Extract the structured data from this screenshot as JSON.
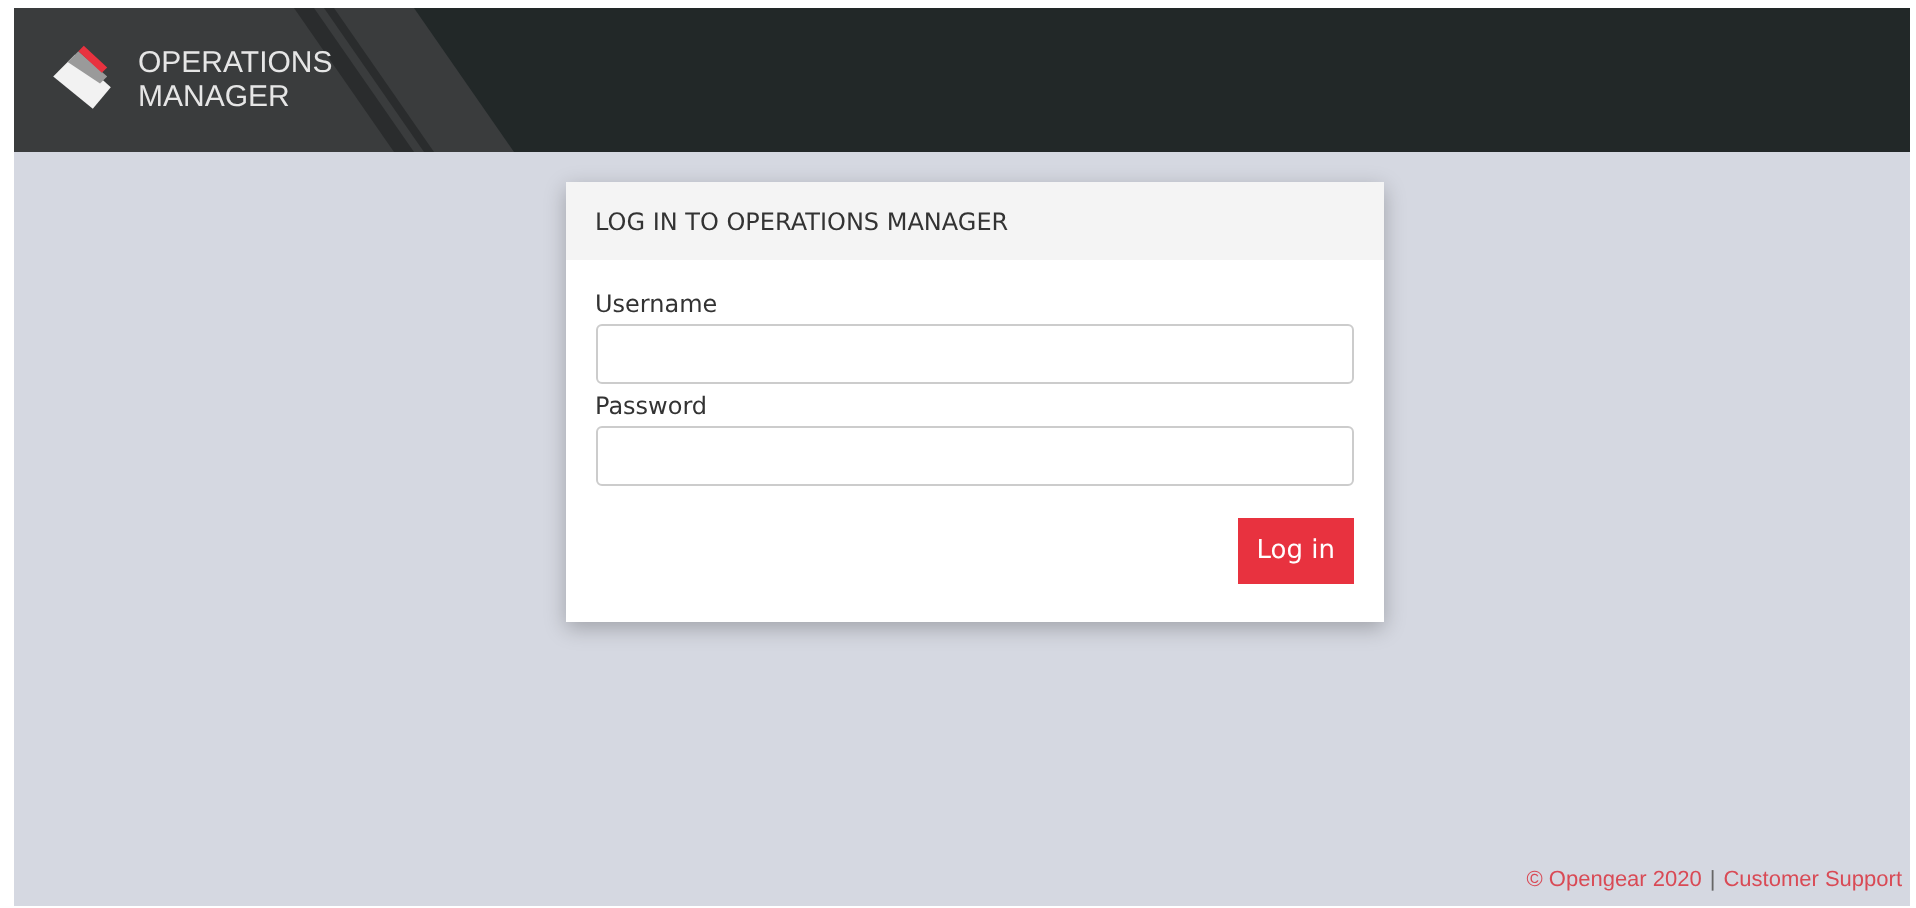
{
  "header": {
    "logo_text": [
      "OPERATIONS",
      "MANAGER"
    ]
  },
  "login_card": {
    "title": "LOG IN TO OPERATIONS MANAGER",
    "fields": [
      {
        "label": "Username"
      },
      {
        "label": "Password"
      }
    ],
    "button": "Log in"
  },
  "footer": {
    "copyright": "© Opengear 2020",
    "separator": "|",
    "link": "Customer Support"
  }
}
